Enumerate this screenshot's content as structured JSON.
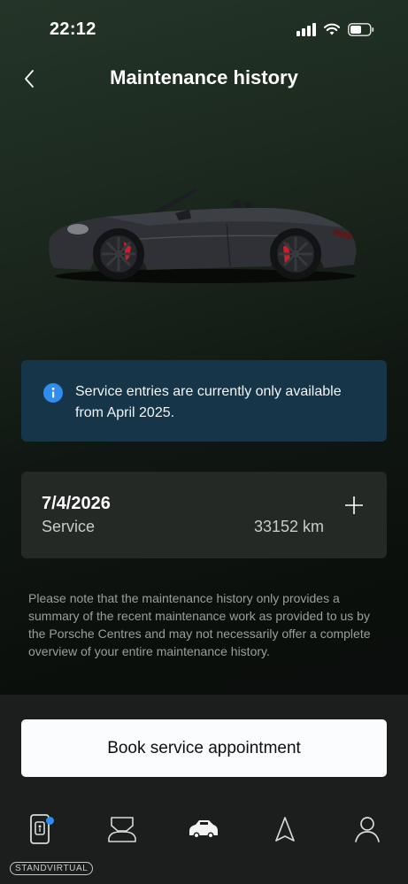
{
  "status_bar": {
    "time": "22:12"
  },
  "header": {
    "title": "Maintenance history"
  },
  "info_banner": {
    "text": "Service entries are currently only available from April 2025."
  },
  "service_entries": [
    {
      "date": "7/4/2026",
      "type": "Service",
      "mileage": "33152 km"
    }
  ],
  "disclaimer": "Please note that the maintenance history only provides a summary of the recent maintenance work as provided to us by the Porsche Centres and may not necessarily offer a complete overview of your entire maintenance history.",
  "book_button": {
    "label": "Book service appointment"
  },
  "tab_bar": {
    "tabs": [
      {
        "icon": "phone-key-icon",
        "badge": true
      },
      {
        "icon": "car-service-icon",
        "badge": false
      },
      {
        "icon": "car-icon",
        "badge": false,
        "active": true
      },
      {
        "icon": "navigation-arrow-icon",
        "badge": false
      },
      {
        "icon": "profile-icon",
        "badge": false
      }
    ]
  },
  "watermark": "STANDVIRTUAL",
  "colors": {
    "info_banner_bg": "#163549",
    "info_icon": "#2f8cf1",
    "card_bg": "#252926",
    "badge": "#2f8cf1",
    "button_bg": "#fbfcfd"
  }
}
